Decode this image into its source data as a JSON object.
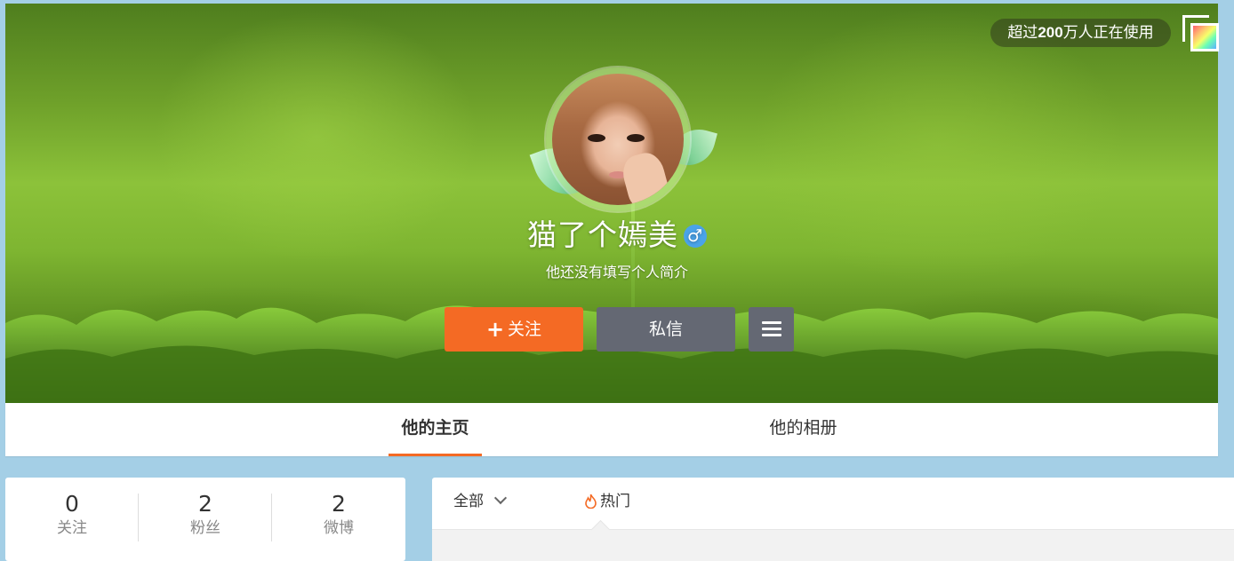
{
  "header": {
    "users_badge_pre": "超过",
    "users_badge_num": "200",
    "users_badge_post": "万人正在使用",
    "switch_icon": "cover-switch-icon"
  },
  "profile": {
    "name": "猫了个嫣美",
    "gender_symbol": "♂",
    "bio": "他还没有填写个人简介"
  },
  "actions": {
    "follow_plus": "+",
    "follow_label": "关注",
    "message_label": "私信",
    "more_icon": "menu-icon"
  },
  "tabs": [
    {
      "label": "他的主页",
      "active": true
    },
    {
      "label": "他的相册",
      "active": false
    }
  ],
  "stats": [
    {
      "value": "0",
      "label": "关注"
    },
    {
      "value": "2",
      "label": "粉丝"
    },
    {
      "value": "2",
      "label": "微博"
    }
  ],
  "feed": {
    "filter_all": "全部",
    "filter_hot": "热门"
  },
  "colors": {
    "accent": "#f46a24",
    "button_gray": "#646873",
    "gender_blue": "#4aa3e8",
    "page_bg": "#a4cfe6"
  }
}
